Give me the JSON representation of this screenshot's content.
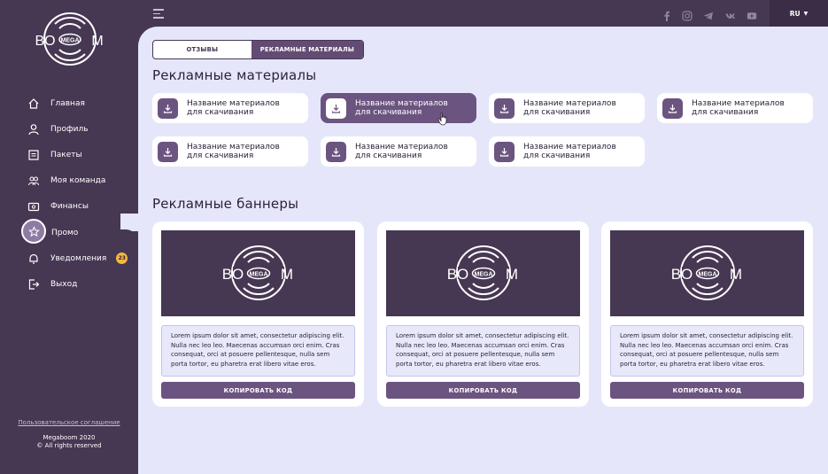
{
  "brand": {
    "logo_text_left": "BO",
    "logo_text_mega": "MEGA",
    "logo_text_right": "M"
  },
  "sidebar": {
    "items": [
      {
        "label": "Главная",
        "icon": "home-icon"
      },
      {
        "label": "Профиль",
        "icon": "user-icon"
      },
      {
        "label": "Пакеты",
        "icon": "package-icon"
      },
      {
        "label": "Моя команда",
        "icon": "team-icon"
      },
      {
        "label": "Финансы",
        "icon": "wallet-icon"
      },
      {
        "label": "Промо",
        "icon": "star-icon",
        "active": true
      },
      {
        "label": "Уведомления",
        "icon": "bell-icon",
        "badge": "23"
      },
      {
        "label": "Выход",
        "icon": "logout-icon"
      }
    ],
    "agreement_link": "Пользовательское соглашение",
    "copyright_line1": "Megaboom 2020",
    "copyright_line2": "© All rights reserved"
  },
  "topbar": {
    "socials": [
      "facebook-icon",
      "instagram-icon",
      "telegram-icon",
      "vk-icon",
      "youtube-icon"
    ],
    "language": "RU"
  },
  "tabs": [
    {
      "label": "ОТЗЫВЫ",
      "active": false
    },
    {
      "label": "РЕКЛАМНЫЕ МАТЕРИАЛЫ",
      "active": true
    }
  ],
  "materials": {
    "title": "Рекламные материалы",
    "items": [
      {
        "line1": "Название материалов",
        "line2": "для скачивания"
      },
      {
        "line1": "Название материалов",
        "line2": "для скачивания",
        "active": true
      },
      {
        "line1": "Название материалов",
        "line2": "для скачивания"
      },
      {
        "line1": "Название материалов",
        "line2": "для скачивания"
      },
      {
        "line1": "Название материалов",
        "line2": "для скачивания"
      },
      {
        "line1": "Название материалов",
        "line2": "для скачивания"
      },
      {
        "line1": "Название материалов",
        "line2": "для скачивания"
      }
    ]
  },
  "banners": {
    "title": "Рекламные баннеры",
    "items": [
      {
        "text": "Lorem ipsum dolor sit amet, consectetur adipiscing elit. Nulla nec leo leo. Maecenas accumsan orci enim. Cras consequat, orci at posuere pellentesque, nulla sem porta tortor, eu pharetra erat libero vitae eros.",
        "button": "КОПИРОВАТЬ КОД"
      },
      {
        "text": "Lorem ipsum dolor sit amet, consectetur adipiscing elit. Nulla nec leo leo. Maecenas accumsan orci enim. Cras consequat, orci at posuere pellentesque, nulla sem porta tortor, eu pharetra erat libero vitae eros.",
        "button": "КОПИРОВАТЬ КОД"
      },
      {
        "text": "Lorem ipsum dolor sit amet, consectetur adipiscing elit. Nulla nec leo leo. Maecenas accumsan orci enim. Cras consequat, orci at posuere pellentesque, nulla sem porta tortor, eu pharetra erat libero vitae eros.",
        "button": "КОПИРОВАТЬ КОД"
      }
    ]
  },
  "colors": {
    "sidebar": "#463752",
    "main_bg": "#e6e6fb",
    "accent": "#6b5480",
    "badge": "#f5b83d"
  }
}
